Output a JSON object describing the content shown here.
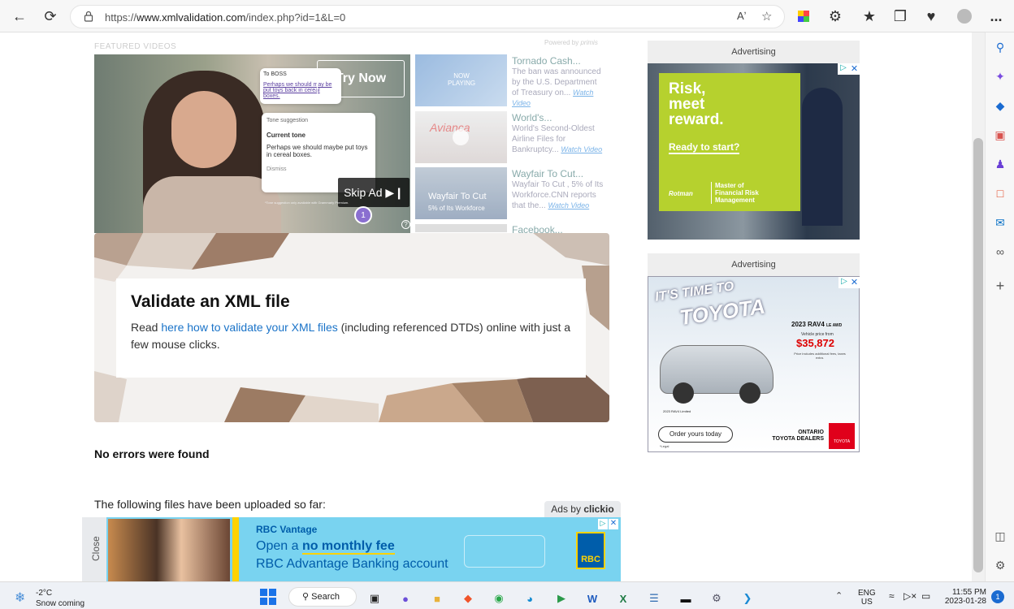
{
  "browser": {
    "url_prefix": "https://",
    "url_domain": "www.xmlvalidation.com",
    "url_path": "/index.php?id=1&L=0",
    "reader_icon_text": "Aʼ",
    "more_label": "..."
  },
  "featured": {
    "label": "FEATURED VIDEOS",
    "powered_by": "Powered by",
    "provider": "primis",
    "player": {
      "try_now": "Try Now",
      "skip_ad": "Skip Ad",
      "countdown": "1",
      "mini_email_to": "To BOSS",
      "mini_email_text": "Perhaps we should may be put toys back in cereal boxes.",
      "suggestion_title": "Tone suggestion",
      "current_tone": "Current tone",
      "suggestion_text": "Perhaps we should maybe put toys in cereal boxes.",
      "dismiss": "Dismiss",
      "small_note": "*Tone suggestion only available with Grammarly Premium."
    },
    "list": [
      {
        "title": "Tornado Cash...",
        "text": "The ban was announced by the U.S. Department of Treasury on...",
        "watch": "Watch Video",
        "thumb_label": "NOW PLAYING"
      },
      {
        "title": "World's...",
        "text": "World's Second-Oldest Airline Files for Bankruptcy...",
        "watch": "Watch Video",
        "thumb_label": "Avianca"
      },
      {
        "title": "Wayfair To Cut...",
        "text": "Wayfair To Cut , 5% of Its Workforce.CNN reports that the...",
        "watch": "Watch Video",
        "thumb_label": "Wayfair To Cut",
        "thumb_sub": "5% of Its Workforce"
      },
      {
        "title": "Facebook..."
      }
    ]
  },
  "hero": {
    "title": "Validate an XML file",
    "body_before": "Read",
    "link": "here how to validate your XML files",
    "body_after": "(including referenced DTDs) online with just a few mouse clicks."
  },
  "result": {
    "no_errors": "No errors were found",
    "uploaded": "The following files have been uploaded so far:"
  },
  "ads": {
    "label1": "Advertising",
    "label2": "Advertising",
    "ad1": {
      "headline_1": "Risk,",
      "headline_2": "meet",
      "headline_3": "reward.",
      "cta": "Ready to start?",
      "brand": "Rotman",
      "program": "Master of Financial Risk Management"
    },
    "ad2": {
      "headline_1": "IT'S TIME TO",
      "headline_2": "TOYOTA",
      "model": "2023 RAV4",
      "model_suffix": "LE AWD",
      "price_label": "Vehicle price from",
      "price": "$35,872",
      "price_note": "Price includes additional fees, taxes extra.",
      "vehicle_note": "2023 RAV4 Limited",
      "cta": "Order yours today",
      "legal": "*Legal",
      "dealer_1": "ONTARIO",
      "dealer_2": "TOYOTA DEALERS",
      "logo_text": "TOYOTA"
    },
    "bottom": {
      "ads_by": "Ads by",
      "ads_brand": "clickio",
      "close": "Close",
      "brand_line": "RBC Vantage",
      "line1_before": "Open a",
      "line1_em": "no monthly fee",
      "line2": "RBC Advantage Banking account",
      "logo": "RBC"
    }
  },
  "taskbar": {
    "weather_temp": "-2°C",
    "weather_desc": "Snow coming",
    "search": "Search",
    "lang_1": "ENG",
    "lang_2": "US",
    "time": "11:55 PM",
    "date": "2023-01-28",
    "notif": "1"
  },
  "colors": {
    "accent_blue": "#1a73c8",
    "ad_green": "#b6d12e",
    "rbc_blue": "#005daa",
    "bottom_ad_bg": "#79d3f0"
  }
}
